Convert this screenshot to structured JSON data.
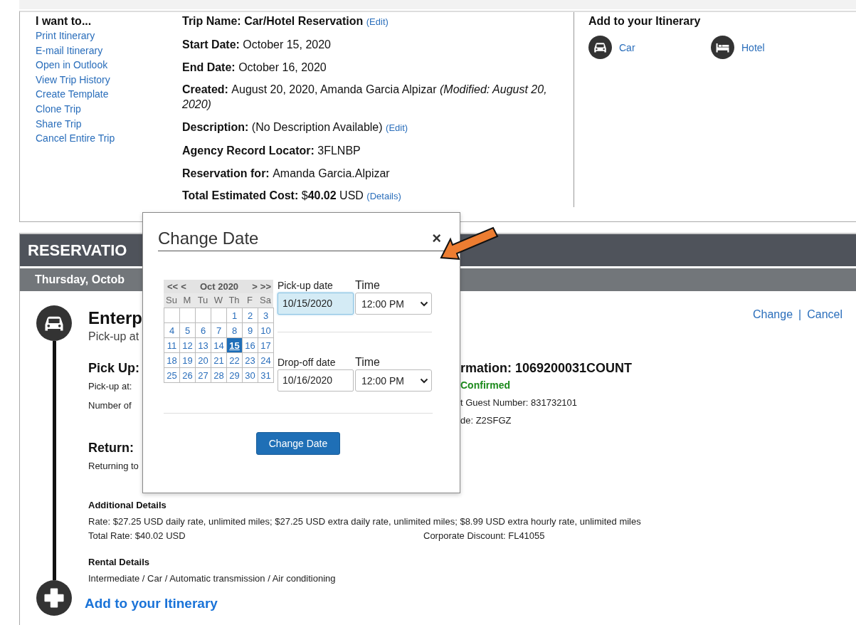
{
  "actions": {
    "title": "I want to...",
    "links": [
      "Print Itinerary",
      "E-mail Itinerary",
      "Open in Outlook",
      "View Trip History",
      "Create Template",
      "Clone Trip",
      "Share Trip",
      "Cancel Entire Trip"
    ]
  },
  "trip": {
    "fields": [
      {
        "kind": "title",
        "label": "Trip Name:",
        "value": "Car/Hotel Reservation",
        "link": "(Edit)"
      },
      {
        "kind": "plain",
        "label": "Start Date:",
        "value": "October 15, 2020"
      },
      {
        "kind": "plain",
        "label": "End Date:",
        "value": "October 16, 2020"
      },
      {
        "kind": "plain",
        "label": "Created:",
        "value": "August 20, 2020, Amanda Garcia Alpizar *(Modified: August 20, 2020)*"
      },
      {
        "kind": "plain",
        "label": "Description:",
        "value": "(No Description Available)",
        "link": "(Edit)"
      },
      {
        "kind": "plain",
        "label": "Agency Record Locator:",
        "value": "3FLNBP"
      },
      {
        "kind": "plain",
        "label": "Reservation for:",
        "value": "Amanda Garcia.Alpizar"
      },
      {
        "kind": "plain",
        "label": "Total Estimated Cost:",
        "value": "$**40.02** USD",
        "link": "(Details)"
      }
    ]
  },
  "add_itinerary": {
    "title": "Add to your Itinerary",
    "options": [
      {
        "kind": "car",
        "label": "Car"
      },
      {
        "kind": "hotel",
        "label": "Hotel"
      }
    ]
  },
  "reservations": {
    "header": "RESERVATIO",
    "date_bar": "Thursday, Octob",
    "actions": [
      "Change",
      "Cancel"
    ],
    "separator": "|"
  },
  "booking": {
    "title": "Enterp",
    "subtitle": "Pick-up at",
    "pickup": {
      "heading": "Pick Up:",
      "lines": [
        "Pick-up at:",
        "Number of"
      ]
    },
    "confirmation": {
      "heading": "rmation: 1069200031COUNT",
      "status": "Confirmed",
      "lines": [
        "t Guest Number: 831732101",
        "de: Z2SFGZ"
      ]
    },
    "return": {
      "heading": "Return:",
      "lines": [
        "Returning to"
      ]
    },
    "additional": {
      "heading": "Additional Details",
      "rate": "Rate: $27.25 USD daily rate, unlimited miles; $27.25 USD extra daily rate, unlimited miles; $8.99 USD extra hourly rate, unlimited miles",
      "total_rate": "Total Rate: $40.02 USD",
      "discount": "Corporate Discount: FL41055"
    },
    "rental": {
      "heading": "Rental Details",
      "text": "Intermediate / Car / Automatic transmission / Air conditioning"
    },
    "add_link": "Add to your Itinerary"
  },
  "dialog": {
    "title": "Change Date",
    "close": "×",
    "calendar": {
      "nav_prev": [
        "<<",
        "<"
      ],
      "month": "Oct 2020",
      "nav_next": [
        ">",
        ">>"
      ],
      "weekdays": [
        "Su",
        "M",
        "Tu",
        "W",
        "Th",
        "F",
        "Sa"
      ],
      "days": [
        {
          "kind": "blank"
        },
        {
          "kind": "blank"
        },
        {
          "kind": "blank"
        },
        {
          "kind": "blank"
        },
        {
          "kind": "day",
          "label": "1",
          "selected": false
        },
        {
          "kind": "day",
          "label": "2",
          "selected": false
        },
        {
          "kind": "day",
          "label": "3",
          "selected": false
        },
        {
          "kind": "day",
          "label": "4",
          "selected": false
        },
        {
          "kind": "day",
          "label": "5",
          "selected": false
        },
        {
          "kind": "day",
          "label": "6",
          "selected": false
        },
        {
          "kind": "day",
          "label": "7",
          "selected": false
        },
        {
          "kind": "day",
          "label": "8",
          "selected": false
        },
        {
          "kind": "day",
          "label": "9",
          "selected": false
        },
        {
          "kind": "day",
          "label": "10",
          "selected": false
        },
        {
          "kind": "day",
          "label": "11",
          "selected": false
        },
        {
          "kind": "day",
          "label": "12",
          "selected": false
        },
        {
          "kind": "day",
          "label": "13",
          "selected": false
        },
        {
          "kind": "day",
          "label": "14",
          "selected": false
        },
        {
          "kind": "day",
          "label": "15",
          "selected": true
        },
        {
          "kind": "day",
          "label": "16",
          "selected": false
        },
        {
          "kind": "day",
          "label": "17",
          "selected": false
        },
        {
          "kind": "day",
          "label": "18",
          "selected": false
        },
        {
          "kind": "day",
          "label": "19",
          "selected": false
        },
        {
          "kind": "day",
          "label": "20",
          "selected": false
        },
        {
          "kind": "day",
          "label": "21",
          "selected": false
        },
        {
          "kind": "day",
          "label": "22",
          "selected": false
        },
        {
          "kind": "day",
          "label": "23",
          "selected": false
        },
        {
          "kind": "day",
          "label": "24",
          "selected": false
        },
        {
          "kind": "day",
          "label": "25",
          "selected": false
        },
        {
          "kind": "day",
          "label": "26",
          "selected": false
        },
        {
          "kind": "day",
          "label": "27",
          "selected": false
        },
        {
          "kind": "day",
          "label": "28",
          "selected": false
        },
        {
          "kind": "day",
          "label": "29",
          "selected": false
        },
        {
          "kind": "day",
          "label": "30",
          "selected": false
        },
        {
          "kind": "day",
          "label": "31",
          "selected": false
        }
      ]
    },
    "fields": [
      {
        "date_label": "Pick-up date",
        "date_value": "10/15/2020",
        "focused": true,
        "time_label": "Time",
        "time_value": "12:00 PM"
      },
      {
        "date_label": "Drop-off date",
        "date_value": "10/16/2020",
        "focused": false,
        "time_label": "Time",
        "time_value": "12:00 PM"
      }
    ],
    "button": "Change Date"
  }
}
